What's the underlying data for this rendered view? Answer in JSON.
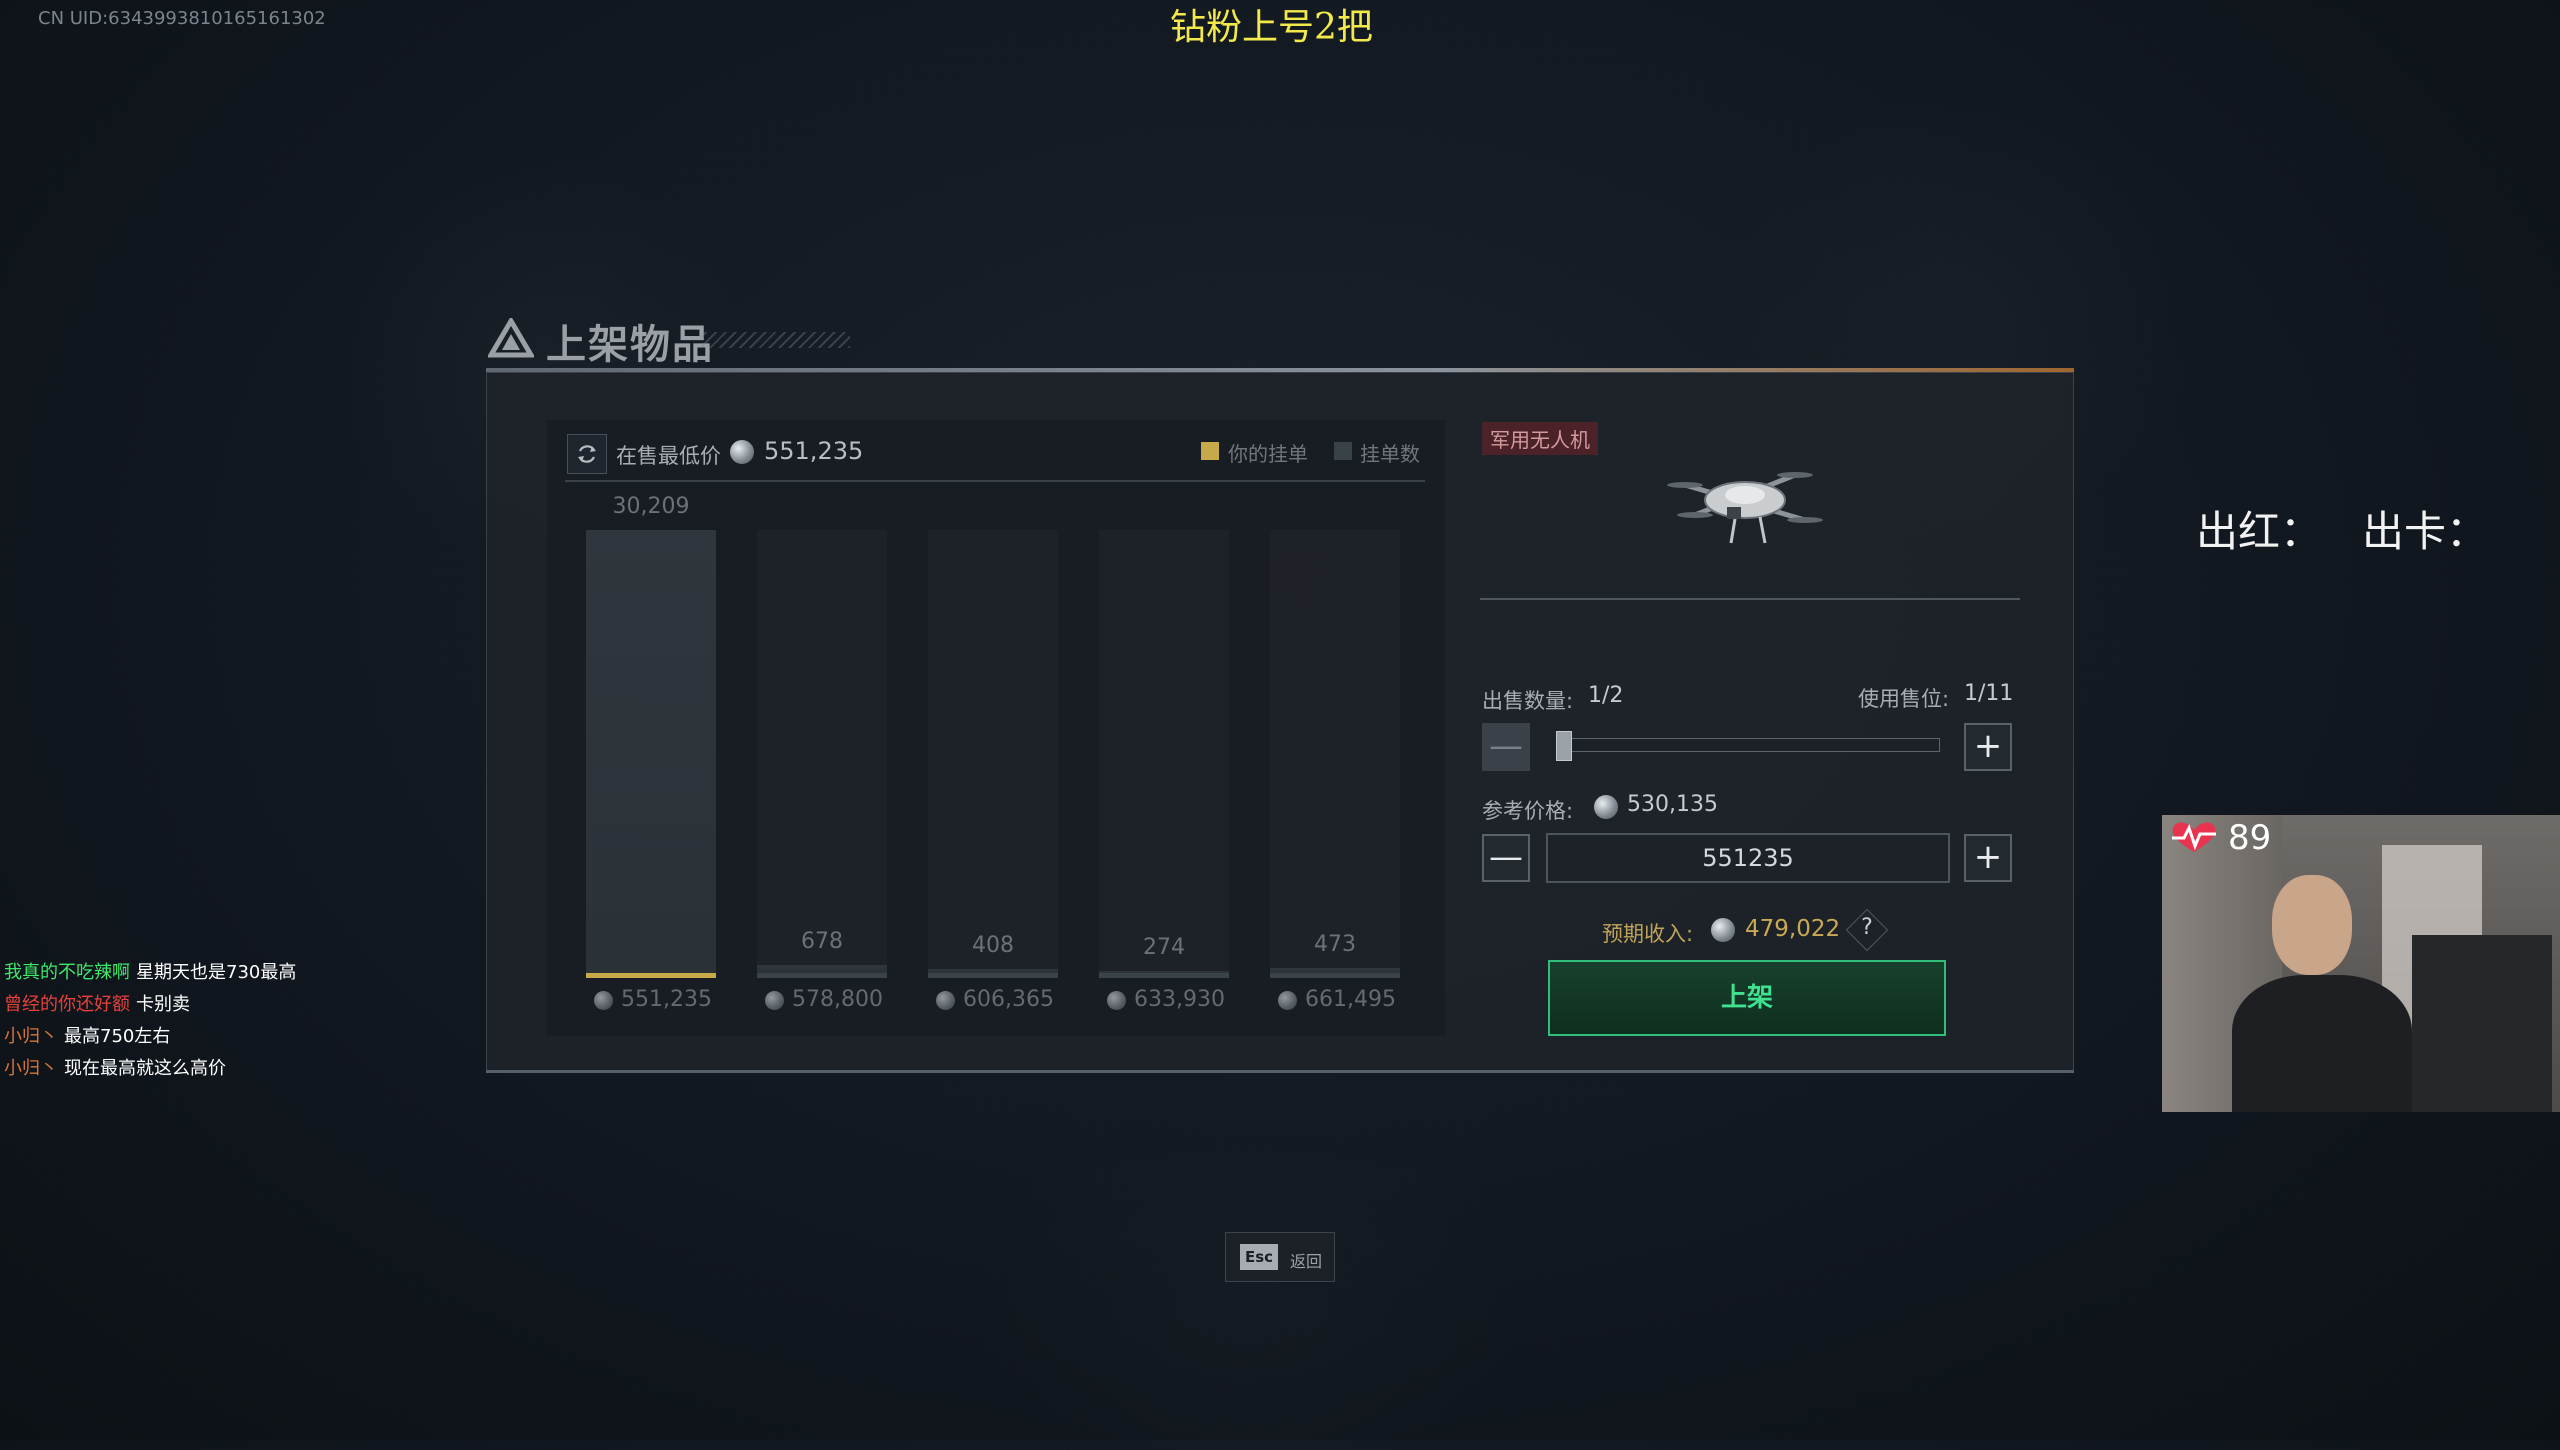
{
  "overlay": {
    "uid": "CN UID:6343993810165161302",
    "stream_title": "钻粉上号2把",
    "stat_red": "出红：",
    "stat_card": "出卡：",
    "viewer_count": "89"
  },
  "dialog": {
    "title": "上架物品"
  },
  "market": {
    "lowest_label": "在售最低价",
    "lowest_price": "551,235",
    "legend_mine": "你的挂单",
    "legend_count": "挂单数"
  },
  "chart_data": {
    "type": "bar",
    "categories": [
      "551,235",
      "578,800",
      "606,365",
      "633,930",
      "661,495"
    ],
    "values": [
      30209,
      678,
      408,
      274,
      473
    ],
    "value_labels": [
      "30,209",
      "678",
      "408",
      "274",
      "473"
    ],
    "ylim": [
      0,
      30209
    ],
    "series": [
      {
        "name": "挂单数",
        "values": [
          30209,
          678,
          408,
          274,
          473
        ]
      }
    ]
  },
  "item": {
    "tag": "军用无人机"
  },
  "sell": {
    "quantity_label": "出售数量:",
    "quantity_value": "1/2",
    "slots_label": "使用售位:",
    "slots_value": "1/11",
    "quantity_fraction": 0.0
  },
  "price": {
    "ref_label": "参考价格:",
    "ref_value": "530,135",
    "input_value": "551235",
    "minus": "—",
    "plus": "+"
  },
  "income": {
    "label": "预期收入:",
    "value": "479,022",
    "help": "?"
  },
  "actions": {
    "list_label": "上架",
    "esc_key": "Esc",
    "esc_label": "返回"
  },
  "chat": [
    {
      "name": "我真的不吃辣啊",
      "name_color": "#3ee86a",
      "text": "星期天也是730最高"
    },
    {
      "name": "曾经的你还好额",
      "name_color": "#e8413a",
      "text": "卡别卖"
    },
    {
      "name": "小归丶",
      "name_color": "#d8753a",
      "text": "最高750左右"
    },
    {
      "name": "小归丶",
      "name_color": "#d8753a",
      "text": "现在最高就这么高价"
    }
  ]
}
